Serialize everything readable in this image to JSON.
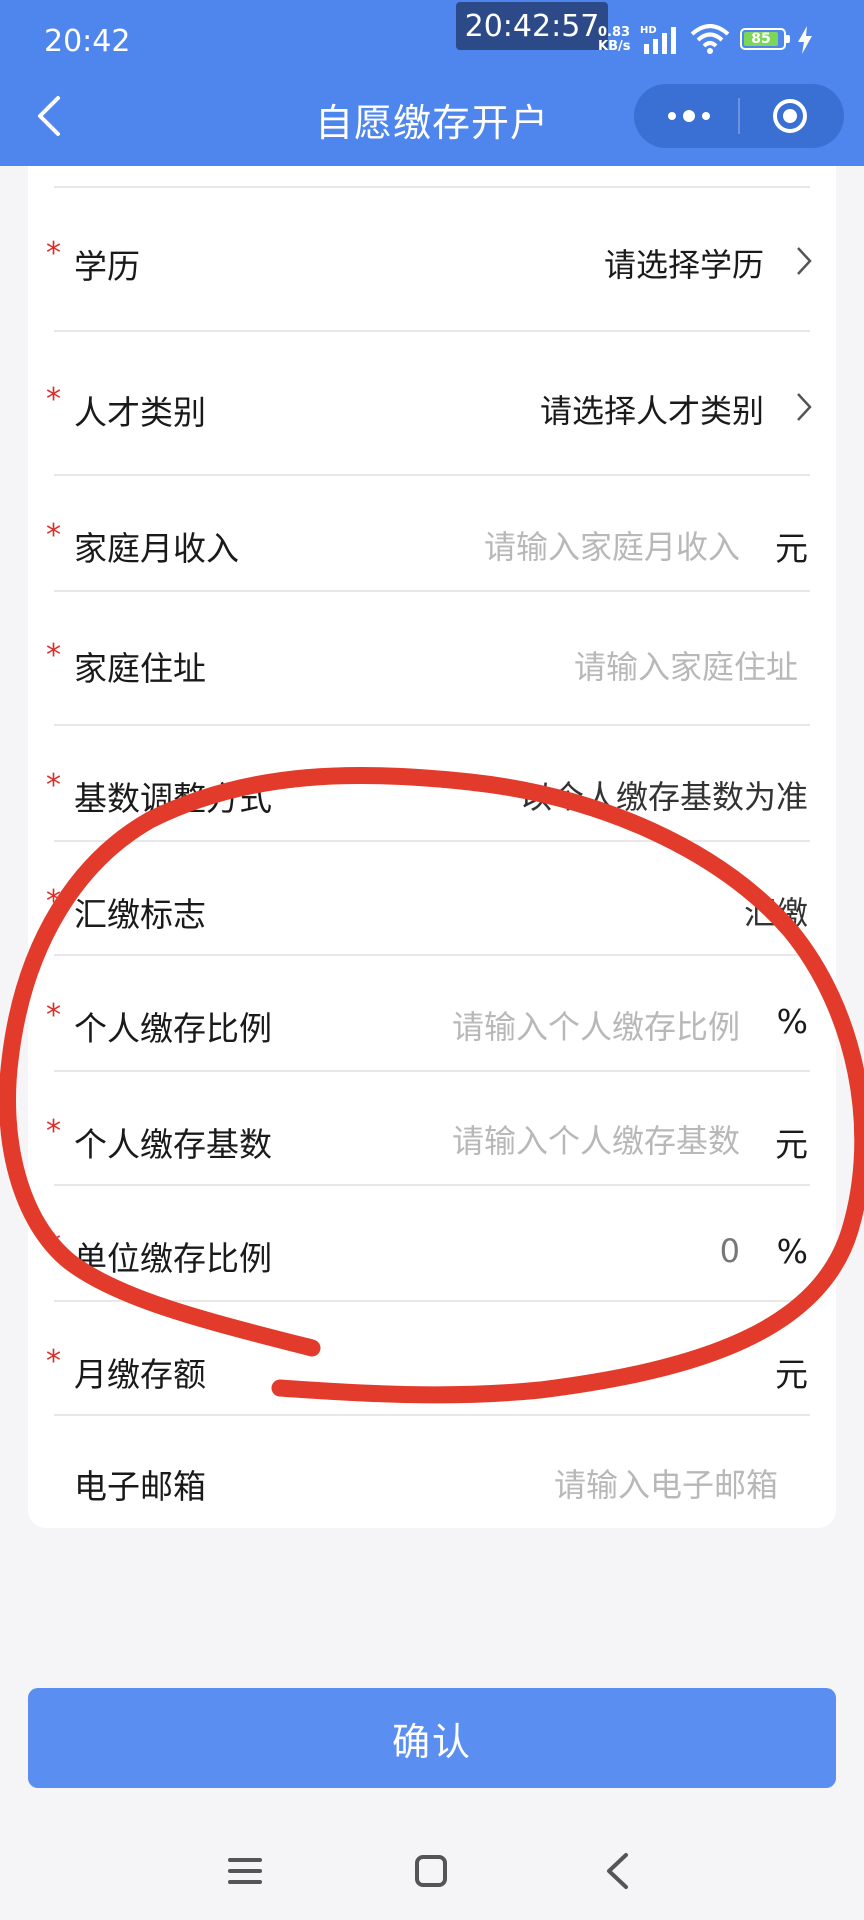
{
  "status_bar": {
    "time": "20:42",
    "clock_overlay": "20:42:57",
    "net_speed_value": "0.83",
    "net_speed_unit": "KB/s",
    "net_hd": "HD",
    "battery": "85"
  },
  "header": {
    "title": "自愿缴存开户"
  },
  "form": {
    "rows": [
      {
        "label": "学历",
        "value": "请选择学历"
      },
      {
        "label": "人才类别",
        "value": "请选择人才类别"
      },
      {
        "label": "家庭月收入",
        "placeholder": "请输入家庭月收入",
        "unit": "元"
      },
      {
        "label": "家庭住址",
        "placeholder": "请输入家庭住址"
      },
      {
        "label": "基数调整方式",
        "value": "以个人缴存基数为准"
      },
      {
        "label": "汇缴标志",
        "value": "汇缴"
      },
      {
        "label": "个人缴存比例",
        "placeholder": "请输入个人缴存比例",
        "unit": "%"
      },
      {
        "label": "个人缴存基数",
        "placeholder": "请输入个人缴存基数",
        "unit": "元"
      },
      {
        "label": "单位缴存比例",
        "value": "0",
        "unit": "%"
      },
      {
        "label": "月缴存额",
        "value": "",
        "unit": "元"
      },
      {
        "label": "电子邮箱",
        "placeholder": "请输入电子邮箱"
      }
    ]
  },
  "confirm_label": "确认",
  "colors": {
    "primary": "#4f86ee",
    "button": "#5a8ef0",
    "required": "#d9302c",
    "annotation": "#e23b2b"
  }
}
